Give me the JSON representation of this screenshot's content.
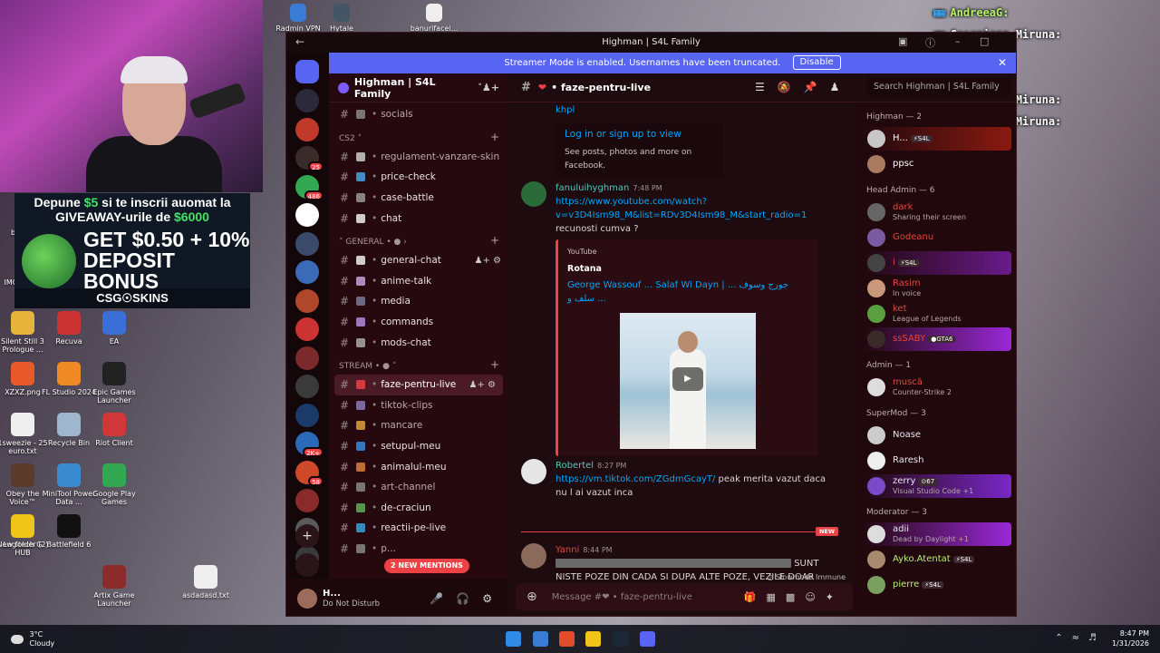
{
  "desktop": {
    "icons_top": [
      {
        "label": "Radmin VPN",
        "color": "#3a7bd5"
      },
      {
        "label": "Hytale",
        "color": "#445566"
      },
      {
        "label": "banurifacei...",
        "color": "#eeeeee"
      }
    ],
    "icons_left": [
      {
        "label": "Silent Still 3 Prologue ...",
        "color": "#e8b33b"
      },
      {
        "label": "Recuva",
        "color": "#cc3333"
      },
      {
        "label": "EA",
        "color": "#3a6fd8"
      },
      {
        "label": "XZXZ.png",
        "color": "#e8592c"
      },
      {
        "label": "FL Studio 2024",
        "color": "#f08a24"
      },
      {
        "label": "Epic Games Launcher",
        "color": "#222222"
      },
      {
        "label": "1sweezie - 25 euro.txt",
        "color": "#eeeeee"
      },
      {
        "label": "Recycle Bin",
        "color": "#9fb7cc"
      },
      {
        "label": "Riot Client",
        "color": "#d13639"
      },
      {
        "label": "Obey the Voice™",
        "color": "#5a3a2a"
      },
      {
        "label": "MiniTool Power Data ...",
        "color": "#3b8bd0"
      },
      {
        "label": "Google Play Games",
        "color": "#33a852"
      },
      {
        "label": "Logitech G HUB",
        "color": "#222222"
      },
      {
        "label": "Battlefield 6",
        "color": "#111111"
      },
      {
        "label": "New folder (2)",
        "color": "#f0c419"
      },
      {
        "label": "Artix Game Launcher",
        "color": "#8b2b2b"
      },
      {
        "label": "asdadasd.txt",
        "color": "#eeeeee"
      }
    ],
    "partial_labels": [
      "ba",
      "IMG"
    ]
  },
  "promo": {
    "line1_a": "Depune ",
    "line1_amount": "$5",
    "line1_b": " si te inscrii auomat la",
    "line2_a": "GIVEAWAY-urile de ",
    "line2_amount": "$6000",
    "big1": "GET $0.50 + 10%",
    "big2": "DEPOSIT BONUS",
    "footer": "CSG☉SKINS"
  },
  "overlay_chat": [
    {
      "user": "AndreeaG:",
      "msg": "",
      "color": "#b6f26a"
    },
    {
      "user": "Georgiana_Miruna:",
      "msg": "",
      "color": "#ffffff"
    },
    {
      "user": "andre3ya:",
      "msg": "",
      "color": "#ffffff"
    },
    {
      "user": "andre3ya:",
      "msg": "",
      "color": "#ffffff"
    },
    {
      "user": "Georgiana_Miruna:",
      "msg": "",
      "color": "#ffffff"
    },
    {
      "user": "Georgiana_Miruna:",
      "msg": "",
      "color": "#ffffff"
    }
  ],
  "window": {
    "title": "Highman | S4L Family",
    "streamer_banner": "Streamer Mode is enabled. Usernames have been truncated.",
    "disable_label": "Disable"
  },
  "server_badges": [
    "25",
    "486",
    "2K+",
    "58"
  ],
  "guild": {
    "name": "Highman | S4L Family"
  },
  "channels": [
    {
      "kind": "ch",
      "name": "socials",
      "color": "#888888"
    },
    {
      "kind": "cat",
      "name": "CS2 ˅"
    },
    {
      "kind": "ch",
      "name": "regulament-vanzare-skin",
      "color": "#cccccc"
    },
    {
      "kind": "ch",
      "name": "price-check",
      "color": "#4aa3df",
      "bright": true
    },
    {
      "kind": "ch",
      "name": "case-battle",
      "color": "#999999",
      "bright": true
    },
    {
      "kind": "ch",
      "name": "chat",
      "color": "#eeeeee",
      "bright": true
    },
    {
      "kind": "cat",
      "name": "˃ GENERAL • ● ›"
    },
    {
      "kind": "ch",
      "name": "general-chat",
      "color": "#eeeeee",
      "bright": true,
      "tools": true
    },
    {
      "kind": "ch",
      "name": "anime-talk",
      "color": "#c9a0dc",
      "bright": true
    },
    {
      "kind": "ch",
      "name": "media",
      "color": "#7a7a9a",
      "bright": true
    },
    {
      "kind": "ch",
      "name": "commands",
      "color": "#b08cd8",
      "bright": true
    },
    {
      "kind": "ch",
      "name": "mods-chat",
      "color": "#aaaaaa",
      "bright": true
    },
    {
      "kind": "cat",
      "name": "STREAM • ● ˅"
    },
    {
      "kind": "ch",
      "name": "faze-pentru-live",
      "color": "#ed4245",
      "active": true,
      "tools": true
    },
    {
      "kind": "ch",
      "name": "tiktok-clips",
      "color": "#8a7ab8"
    },
    {
      "kind": "ch",
      "name": "mancare",
      "color": "#e0a040"
    },
    {
      "kind": "ch",
      "name": "setupul-meu",
      "color": "#3a8ad8",
      "bright": true
    },
    {
      "kind": "ch",
      "name": "animalul-meu",
      "color": "#d88040",
      "bright": true
    },
    {
      "kind": "ch",
      "name": "art-channel",
      "color": "#888888"
    },
    {
      "kind": "ch",
      "name": "de-craciun",
      "color": "#5ab050",
      "bright": true
    },
    {
      "kind": "ch",
      "name": "reactii-pe-live",
      "color": "#3aa0d8",
      "bright": true
    },
    {
      "kind": "ch",
      "name": "p...",
      "color": "#888888"
    }
  ],
  "new_mentions": "2 NEW MENTIONS",
  "user_panel": {
    "name": "H...",
    "status": "Do Not Disturb"
  },
  "chat": {
    "channel": "faze-pentru-live",
    "search_placeholder": "Search Highman | S4L Family",
    "message_placeholder": "Message #❤ • faze-pentru-live",
    "fb_prefix": "khpl",
    "fb_login": "Log in or sign up to view",
    "fb_sub": "See posts, photos and more on Facebook.",
    "msg1": {
      "author": "fanuluihyghman",
      "time": "7:48 PM",
      "link": "https://www.youtube.com/watch?v=v3D4Ism98_M&list=RDv3D4Ism98_M&start_radio=1",
      "text": " recunosti cumva ?"
    },
    "embed": {
      "provider": "YouTube",
      "author": "Rotana",
      "title": "George Wassouf ... Salaf Wi Dayn | جورج وسوف ... سلف و ..."
    },
    "msg2": {
      "author": "Robertel",
      "time": "8:27 PM",
      "link": "https://vm.tiktok.com/ZGdmGcayT/",
      "text": " peak merita vazut daca nu l ai vazut inca"
    },
    "new_label": "NEW",
    "msg3": {
      "author": "Yanni",
      "time": "8:44 PM",
      "text1": "SUNT",
      "text2": "NISTE POZE DIN CADA SI DUPA ALTE POZE, VEZILE DOAR TU PRIMA OARA SI DUPA DACA E ARATA LE, SA FI SAFE"
    },
    "slowmode": "◷ Slowmode Immune"
  },
  "members": [
    {
      "group": "Highman — 2",
      "list": [
        {
          "name": "H...",
          "status": "",
          "color": "#ffffff",
          "tag": "⚡S4L",
          "glow": "linear-gradient(90deg, transparent, #8a1a10)",
          "av": "#c8c8c8"
        },
        {
          "name": "ppsc",
          "status": "",
          "color": "#ffffff",
          "av": "#a87a60"
        }
      ]
    },
    {
      "group": "Head Admin — 6",
      "list": [
        {
          "name": "dark",
          "status": "Sharing their screen",
          "color": "#e0483a",
          "av": "#666666"
        },
        {
          "name": "Godeanu",
          "status": "",
          "color": "#e0483a",
          "av": "#7a5aa0"
        },
        {
          "name": "i",
          "status": "",
          "color": "#e0483a",
          "tag": "⚡S4L",
          "glow": "linear-gradient(90deg, transparent, #6a1a8a)",
          "av": "#444444"
        },
        {
          "name": "Rasim",
          "status": "In voice",
          "color": "#e0483a",
          "av": "#c9987a"
        },
        {
          "name": "ket",
          "status": "League of Legends",
          "color": "#e0483a",
          "av": "#5aa040"
        },
        {
          "name": "ssSABY",
          "status": "",
          "color": "#e0483a",
          "tag": "●GTA6",
          "glow": "linear-gradient(90deg, transparent, #9a28d8)",
          "av": "#3a2a2a"
        }
      ]
    },
    {
      "group": "Admin — 1",
      "list": [
        {
          "name": "muscă",
          "status": "Counter-Strike 2",
          "color": "#e0483a",
          "av": "#dddddd"
        }
      ]
    },
    {
      "group": "SuperMod — 3",
      "list": [
        {
          "name": "Noase",
          "status": "",
          "color": "#e8e8f0",
          "av": "#cccccc"
        },
        {
          "name": "Raresh",
          "status": "",
          "color": "#e8e8f0",
          "av": "#eeeeee"
        },
        {
          "name": "zerry",
          "status": "Visual Studio Code +1",
          "color": "#e8e8f0",
          "tag": "⊙67",
          "glow": "linear-gradient(90deg, transparent, #7a28c8)",
          "av": "#7a4ac8"
        }
      ]
    },
    {
      "group": "Moderator — 3",
      "list": [
        {
          "name": "adii",
          "status": "Dead by Daylight +1",
          "color": "#e8e8f0",
          "glow": "linear-gradient(90deg, transparent, #9a28d8)",
          "av": "#dddddd"
        },
        {
          "name": "Ayko.Atentat",
          "status": "",
          "color": "#b6f26a",
          "tag": "⚡S4L",
          "av": "#a88a70"
        },
        {
          "name": "pierre",
          "status": "",
          "color": "#b6f26a",
          "tag": "⚡S4L",
          "av": "#7aa060"
        }
      ]
    }
  ],
  "taskbar": {
    "temp": "3°C",
    "weather": "Cloudy",
    "time": "8:47 PM",
    "date": "1/31/2026",
    "apps": [
      "#2f8be8",
      "#3a7bd5",
      "#e24c2a",
      "#f0c419",
      "#1b2838",
      "#5865f2"
    ]
  }
}
